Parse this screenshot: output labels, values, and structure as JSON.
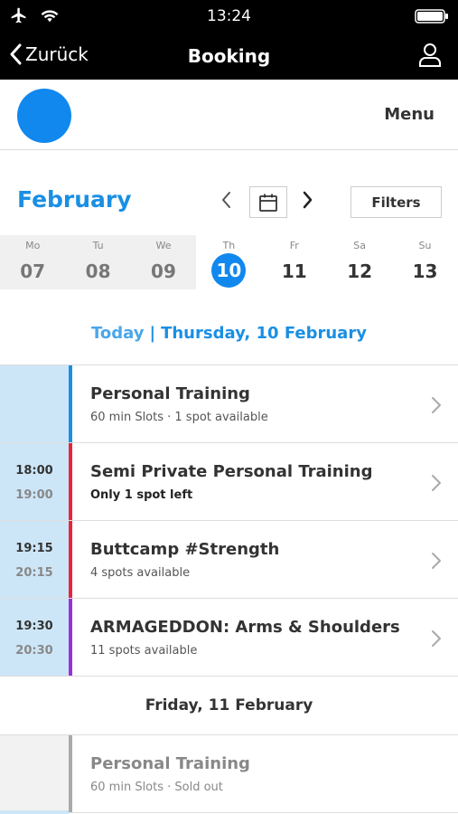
{
  "status": {
    "time": "13:24",
    "icons": [
      "airplane-icon",
      "wifi-icon",
      "battery-icon"
    ]
  },
  "nav": {
    "back_label": "Zurück",
    "title": "Booking"
  },
  "brand": {
    "menu_label": "Menu",
    "logo_color": "#1188ee"
  },
  "calendar": {
    "month": "February",
    "filters_label": "Filters",
    "days": [
      {
        "dow": "Mo",
        "num": "07",
        "state": "past"
      },
      {
        "dow": "Tu",
        "num": "08",
        "state": "past"
      },
      {
        "dow": "We",
        "num": "09",
        "state": "past"
      },
      {
        "dow": "Th",
        "num": "10",
        "state": "selected"
      },
      {
        "dow": "Fr",
        "num": "11",
        "state": "future"
      },
      {
        "dow": "Sa",
        "num": "12",
        "state": "future"
      },
      {
        "dow": "Su",
        "num": "13",
        "state": "future"
      }
    ]
  },
  "today_header": {
    "today": "Today",
    "separator": "|",
    "date": "Thursday, 10 February"
  },
  "classes": [
    {
      "start": "",
      "end": "",
      "name": "Personal Training",
      "info": "60 min Slots · 1 spot available",
      "accent": "#1a8fe3",
      "strong": false
    },
    {
      "start": "18:00",
      "end": "19:00",
      "name": "Semi Private Personal Training",
      "info": "Only 1 spot left",
      "accent": "#e8243c",
      "strong": true
    },
    {
      "start": "19:15",
      "end": "20:15",
      "name": "Buttcamp #Strength",
      "info": "4 spots available",
      "accent": "#e8243c",
      "strong": false
    },
    {
      "start": "19:30",
      "end": "20:30",
      "name": "ARMAGEDDON: Arms & Shoulders",
      "info": "11 spots available",
      "accent": "#9b30d9",
      "strong": false
    }
  ],
  "friday": {
    "header": "Friday, 11 February",
    "classes": [
      {
        "name": "Personal Training",
        "info": "60 min Slots · Sold out",
        "accent": "#aaaaaa"
      }
    ]
  },
  "colors": {
    "accent": "#1a8fe3",
    "selected_day": "#1188ee",
    "time_bg": "#cde6f7"
  }
}
